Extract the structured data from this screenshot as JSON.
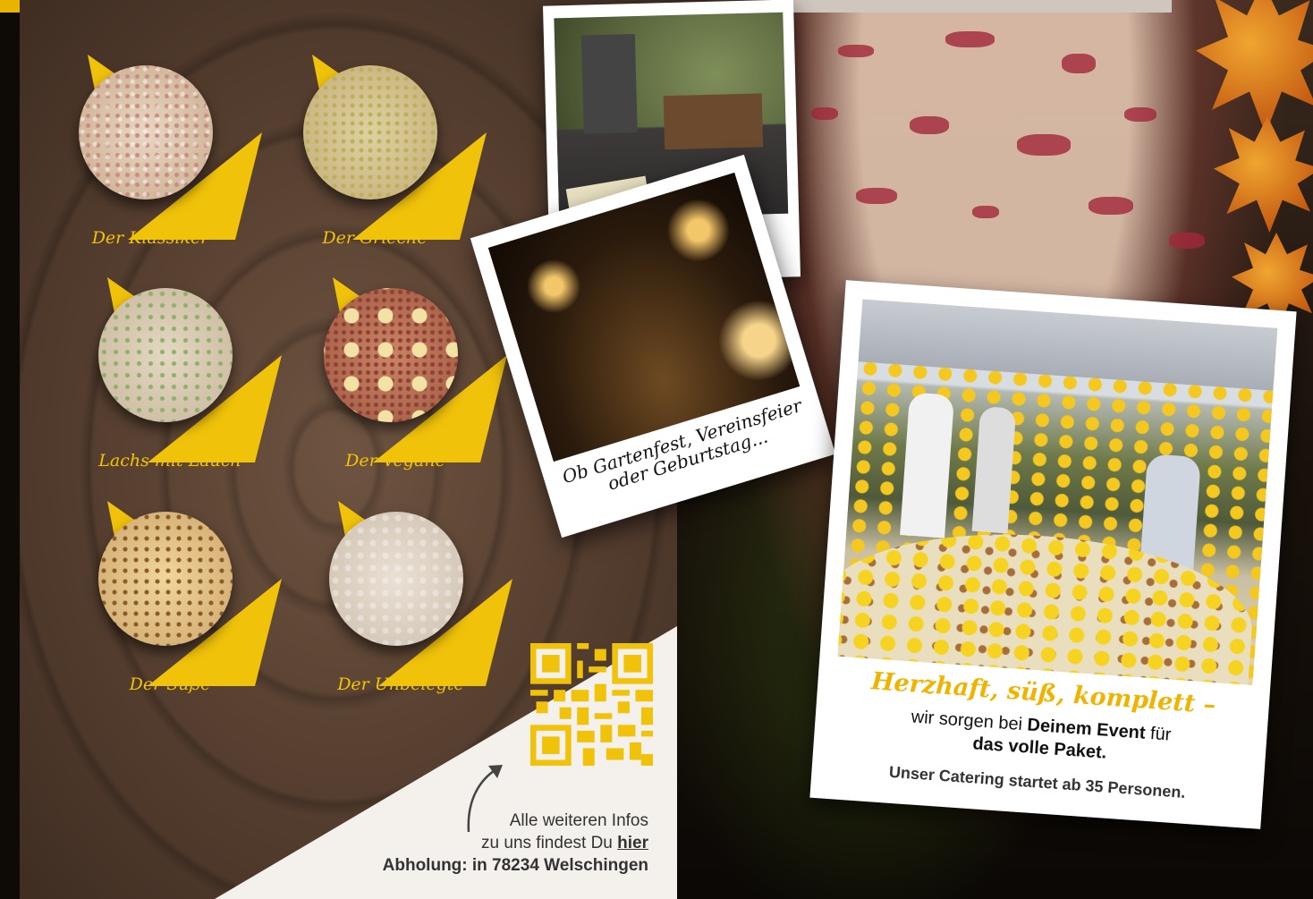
{
  "menu": [
    {
      "name": "Der Klassiker"
    },
    {
      "name": "Der Grieche"
    },
    {
      "name": "Lachs mit Lauch"
    },
    {
      "name": "Der Vegane"
    },
    {
      "name": "Der Süße"
    },
    {
      "name": "Der Unbelegte"
    }
  ],
  "info": {
    "line1": "Alle weiteren Infos",
    "line2_prefix": "zu uns findest Du",
    "line2_link": "hier",
    "line3": "Abholung: in 78234 Welschingen"
  },
  "polaroid2": {
    "caption_line1": "Ob Gartenfest, Vereinsfeier",
    "caption_line2": "oder Geburtstag..."
  },
  "polaroid3": {
    "headline": "Herzhaft, süß, komplett –",
    "text_pre": "wir sorgen bei",
    "text_bold1": "Deinem Event",
    "text_mid": "für",
    "text_bold2": "das volle Paket.",
    "footer": "Unser Catering startet ab 35 Personen."
  },
  "colors": {
    "accent": "#f0c20a",
    "wood": "#5a4232"
  },
  "icons": {
    "qr": "qr-code-icon",
    "arrow": "curved-arrow-icon"
  }
}
